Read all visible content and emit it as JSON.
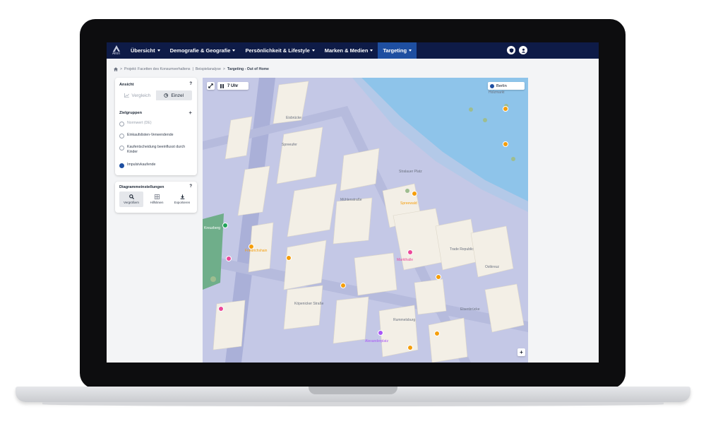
{
  "app": {
    "logo_text": "Allon"
  },
  "nav": {
    "items": [
      {
        "label": "Übersicht"
      },
      {
        "label": "Demografie & Geografie"
      },
      {
        "label": "Persönlichkeit & Lifestyle"
      },
      {
        "label": "Marken & Medien"
      },
      {
        "label": "Targeting"
      }
    ],
    "active": "Targeting",
    "right_icons": [
      "shield-icon",
      "user-icon"
    ]
  },
  "breadcrumb": {
    "home_icon": "home-icon",
    "items": [
      "Projekt: Facetten des Konsumverhaltens",
      "Beispielanalyse",
      "Targeting - Out of Home"
    ],
    "separators": [
      ">",
      "|",
      ">"
    ]
  },
  "ansicht": {
    "title": "Ansicht",
    "help": "?",
    "toggle": [
      {
        "label": "Vergleich",
        "icon": "chart-icon",
        "active": false
      },
      {
        "label": "Einzel",
        "icon": "pie-icon",
        "active": true
      }
    ]
  },
  "zielgruppen": {
    "title": "Zielgruppen",
    "add": "+",
    "items": [
      {
        "label": "Normwert (DE)",
        "checked": false,
        "disabled": true
      },
      {
        "label": "Einkaufslisten-Verwendende",
        "checked": false,
        "disabled": false
      },
      {
        "label": "Kaufentscheidung beeinflusst durch Kinder",
        "checked": false,
        "disabled": false
      },
      {
        "label": "Impulsivkaufende",
        "checked": true,
        "disabled": false
      }
    ]
  },
  "diagramm": {
    "title": "Diagrammeinstellungen",
    "help": "?",
    "tools": [
      {
        "label": "Vergrößern",
        "icon": "zoom-icon",
        "active": true
      },
      {
        "label": "Hilfslinien",
        "icon": "grid-icon",
        "active": false
      },
      {
        "label": "Exportieren",
        "icon": "download-icon",
        "active": false
      }
    ]
  },
  "map": {
    "time_label": "7 Uhr",
    "city_label": "Berlin",
    "zoom_in": "+",
    "labels": [
      "Eisbrücke",
      "Spreeufer",
      "Stralauer Platz",
      "Mühlenstraße",
      "Kreuzberg",
      "Friedrichshain",
      "Köpenicker Straße",
      "Trade Republic",
      "Holzmarkt",
      "Markthalle",
      "Ostkreuz",
      "Rummelsburg",
      "Alexanderplatz",
      "Spreewald",
      "Elsenbrücke"
    ],
    "colors": {
      "water": "#8ec4ea",
      "land": "#c4c8e6",
      "building": "#f3efe6",
      "street": "#b6bbdd"
    }
  }
}
